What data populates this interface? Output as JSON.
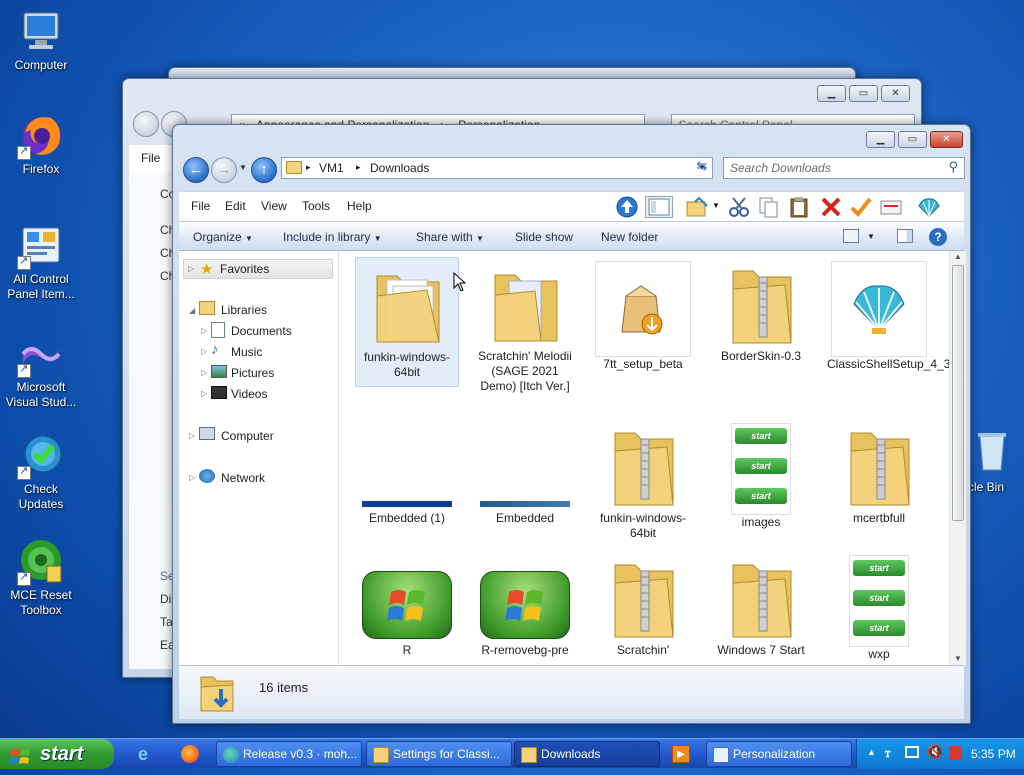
{
  "desktop": {
    "icons": [
      {
        "label": "Computer",
        "icon": "computer-icon"
      },
      {
        "label": "Firefox",
        "icon": "firefox-icon"
      },
      {
        "label": "All Control Panel Item...",
        "icon": "control-panel-icon"
      },
      {
        "label": "Microsoft Visual Stud...",
        "icon": "visual-studio-icon"
      },
      {
        "label": "Check Updates",
        "icon": "check-updates-icon"
      },
      {
        "label": "MCE Reset Toolbox",
        "icon": "mce-reset-icon"
      },
      {
        "label": "cle Bin",
        "icon": "recycle-bin-icon"
      }
    ]
  },
  "back_window": {
    "breadcrumb_prefix": "«",
    "breadcrumb": [
      "Appearance and Personalization",
      "Personalization"
    ],
    "search_placeholder": "Search Control Panel",
    "menu_file": "File",
    "left_fragments": [
      "Co",
      "Ch",
      "Ch",
      "Ch",
      "Se",
      "Dis",
      "Ta",
      "Ea"
    ]
  },
  "explorer": {
    "breadcrumb": [
      "VM1",
      "Downloads"
    ],
    "search_placeholder": "Search Downloads",
    "menu": [
      "File",
      "Edit",
      "View",
      "Tools",
      "Help"
    ],
    "commands": {
      "organize": "Organize",
      "include_in_library": "Include in library",
      "share_with": "Share with",
      "slide_show": "Slide show",
      "new_folder": "New folder"
    },
    "nav": {
      "favorites": "Favorites",
      "libraries": "Libraries",
      "documents": "Documents",
      "music": "Music",
      "pictures": "Pictures",
      "videos": "Videos",
      "computer": "Computer",
      "network": "Network"
    },
    "files": [
      {
        "name": "funkin-windows-64bit",
        "icon": "folder-icon"
      },
      {
        "name": "Scratchin' Melodii (SAGE 2021 Demo) [Itch Ver.]",
        "icon": "folder-icon"
      },
      {
        "name": "7tt_setup_beta",
        "icon": "installer-icon"
      },
      {
        "name": "BorderSkin-0.3",
        "icon": "zip-folder-icon"
      },
      {
        "name": "ClassicShellSetup_4_3_1",
        "icon": "classic-shell-icon"
      },
      {
        "name": "Embedded (1)",
        "icon": "image-strip-icon"
      },
      {
        "name": "Embedded",
        "icon": "image-strip-icon"
      },
      {
        "name": "funkin-windows-64bit",
        "icon": "zip-folder-icon"
      },
      {
        "name": "images",
        "icon": "start-buttons-image-icon"
      },
      {
        "name": "mcertbfull",
        "icon": "zip-folder-icon"
      },
      {
        "name": "R",
        "icon": "windows-logo-image-icon"
      },
      {
        "name": "R-removebg-pre",
        "icon": "windows-logo-image-icon"
      },
      {
        "name": "Scratchin'",
        "icon": "zip-folder-icon"
      },
      {
        "name": "Windows 7 Start",
        "icon": "zip-folder-icon"
      },
      {
        "name": "wxp",
        "icon": "start-buttons-image-icon"
      }
    ],
    "status": "16 items",
    "thumbnail_start_label": "start"
  },
  "taskbar": {
    "start_label": "start",
    "tasks": [
      {
        "label": "Release v0.3 · moh...",
        "icon": "edge-icon",
        "active": false
      },
      {
        "label": "Settings for Classi...",
        "icon": "folder-icon",
        "active": false
      },
      {
        "label": "Downloads",
        "icon": "folder-icon",
        "active": true
      },
      {
        "label": "Personalization",
        "icon": "control-panel-icon",
        "active": false
      }
    ],
    "clock": "5:35 PM"
  },
  "colors": {
    "desktop": "#1a63c4",
    "taskbar": "#235dd2",
    "start_green": "#2f9a2f",
    "folder": "#f3d27b"
  }
}
